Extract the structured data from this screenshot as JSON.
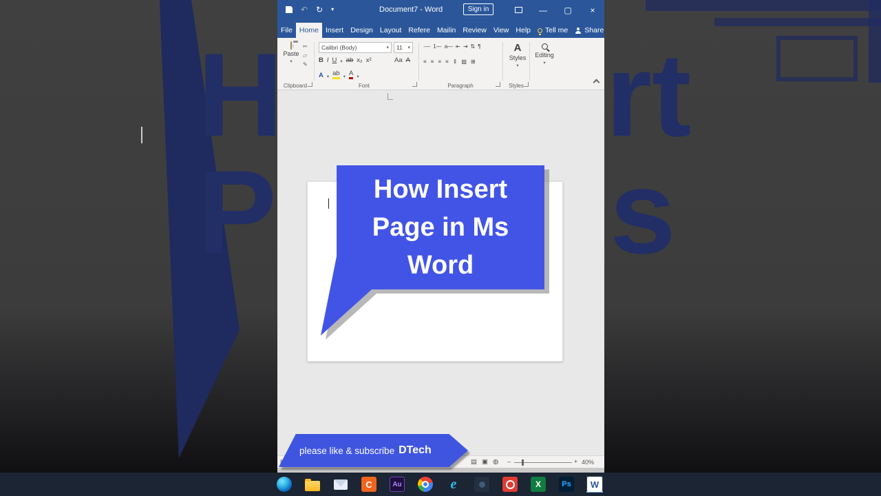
{
  "colors": {
    "word_blue": "#2b579a",
    "ribbon_bg": "#f3f2f1",
    "bubble_blue": "#4254e6",
    "banner_blue": "#3f55e0",
    "taskbar_bg": "#1b2533"
  },
  "glyphs": {
    "undo": "↶",
    "redo": "↻",
    "dropdown": "▾",
    "minimize": "—",
    "maximize": "▢",
    "close": "×",
    "cut": "✂",
    "copy": "▱",
    "format_painter": "✎"
  },
  "titlebar": {
    "title": "Document7 - Word",
    "sign_in": "Sign in"
  },
  "tabs": {
    "file": "File",
    "items": [
      "Home",
      "Insert",
      "Design",
      "Layout",
      "Refere",
      "Mailin",
      "Review",
      "View",
      "Help"
    ],
    "tell_me": "Tell me",
    "share": "Share"
  },
  "ribbon": {
    "paste": "Paste",
    "clipboard_group": "Clipboard",
    "font_name": "Calibri (Body)",
    "font_size": "11",
    "font_group": "Font",
    "font_row1": [
      "B",
      "I",
      "U",
      "ab",
      "x₂",
      "x²"
    ],
    "font_row1_extra": [
      "Aa",
      "A"
    ],
    "font_row2": [
      "A",
      "ab",
      "A"
    ],
    "para_row1": [
      "∙—",
      "1—",
      "a—",
      "⇤",
      "⇥",
      "⇅",
      "¶"
    ],
    "para_row2": [
      "≡",
      "≡",
      "≡",
      "≡",
      "⇕",
      "▨",
      "⊞"
    ],
    "paragraph_group": "Paragraph",
    "styles_icon": "A",
    "styles_label": "Styles",
    "styles_group": "Styles",
    "editing_label": "Editing"
  },
  "statusbar": {
    "left": "Pa",
    "views": [
      "▤",
      "▣",
      "◍"
    ],
    "zoom_out": "–",
    "zoom_in": "+",
    "zoom": "40%"
  },
  "overlay": {
    "bubble_lines": [
      "How Insert",
      "Page in Ms",
      "Word"
    ],
    "banner_text": "please like &  subscribe",
    "banner_brand": "DTech"
  },
  "background": {
    "fragment_left_top": "H",
    "fragment_left_bottom": "P",
    "fragment_right_top": "rt",
    "fragment_right_bottom": "s"
  },
  "taskbar": {
    "letters": {
      "c": "C",
      "audition": "Au",
      "ie": "e",
      "excel": "X",
      "photoshop": "Ps",
      "word": "W"
    }
  }
}
